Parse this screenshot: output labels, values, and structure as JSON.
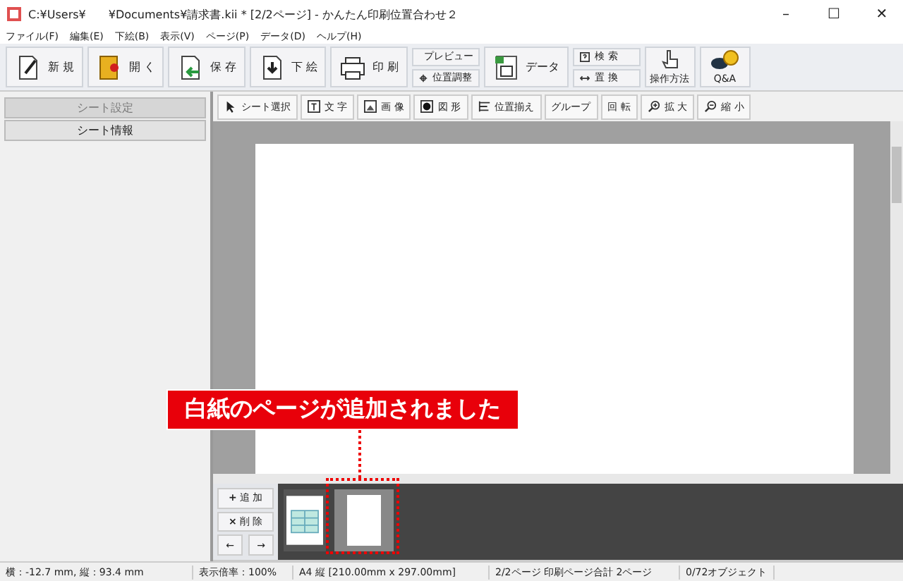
{
  "window": {
    "title": "C:¥Users¥　　¥Documents¥請求書.kii * [2/2ページ] - かんたん印刷位置合わせ２",
    "minimize": "–",
    "maximize": "☐",
    "close": "✕"
  },
  "menu": [
    "ファイル(F)",
    "編集(E)",
    "下絵(B)",
    "表示(V)",
    "ページ(P)",
    "データ(D)",
    "ヘルプ(H)"
  ],
  "toolbar": [
    {
      "kind": "big",
      "label": "新 規"
    },
    {
      "kind": "big",
      "label": "開 く"
    },
    {
      "kind": "big",
      "label": "保 存"
    },
    {
      "kind": "big",
      "label": "下 絵"
    },
    {
      "kind": "big",
      "label": "印 刷"
    },
    {
      "kind": "pair",
      "items": [
        "プレビュー",
        "位置調整"
      ]
    },
    {
      "kind": "big",
      "label": "データ"
    },
    {
      "kind": "pair",
      "items": [
        "検 索",
        "置 換"
      ]
    },
    {
      "kind": "tall",
      "label": "操作方法"
    },
    {
      "kind": "tall",
      "label": "Q&A"
    }
  ],
  "sidebar": {
    "items": [
      {
        "label": "シート設定",
        "disabled": true
      },
      {
        "label": "シート情報",
        "disabled": false
      }
    ]
  },
  "tools": [
    "シート選択",
    "文 字",
    "画 像",
    "図 形",
    "位置揃え",
    "グループ",
    "回 転",
    "拡 大",
    "縮 小"
  ],
  "callout": "白紙のページが追加されました",
  "pages": {
    "buttons": [
      "追 加",
      "削 除"
    ],
    "add_icon": "+",
    "delete_icon": "×",
    "prev": "←",
    "next": "→",
    "thumbnails": [
      {
        "kind": "document",
        "selected": false
      },
      {
        "kind": "blank",
        "selected": true
      }
    ]
  },
  "status_bar": [
    "横：-12.7 mm, 縦：93.4 mm",
    "表示倍率：100%",
    "A4 縦 [210.00mm x 297.00mm]",
    "2/2ページ 印刷ページ合計 2ページ",
    "0/72オブジェクト"
  ]
}
